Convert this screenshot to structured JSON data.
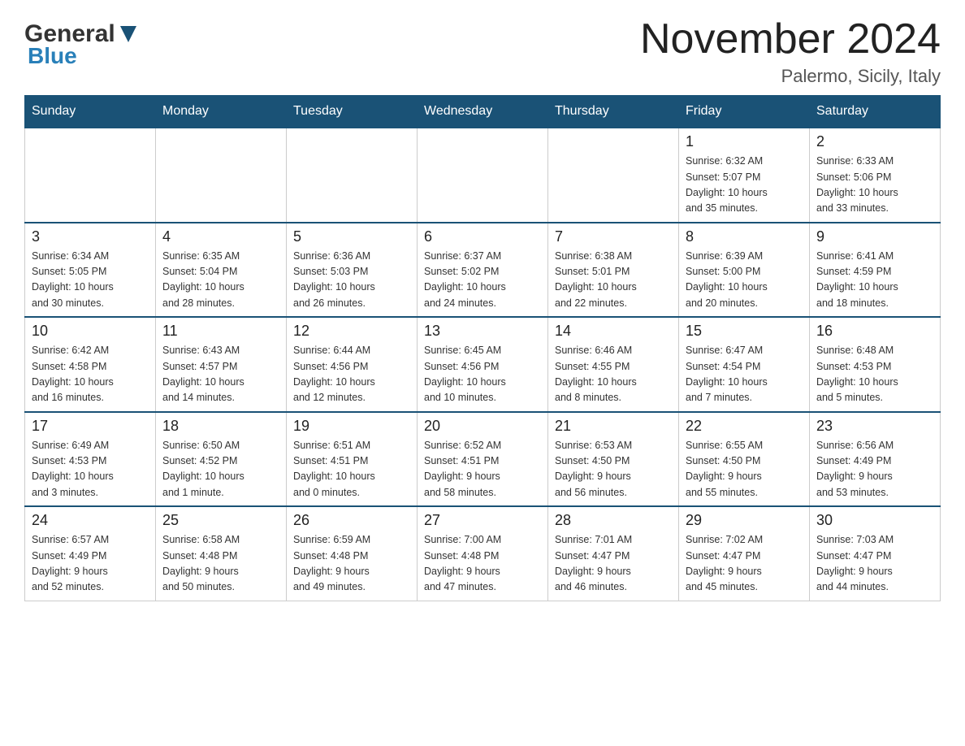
{
  "header": {
    "title": "November 2024",
    "location": "Palermo, Sicily, Italy",
    "logo_general": "General",
    "logo_blue": "Blue"
  },
  "days_of_week": [
    "Sunday",
    "Monday",
    "Tuesday",
    "Wednesday",
    "Thursday",
    "Friday",
    "Saturday"
  ],
  "weeks": [
    {
      "days": [
        {
          "number": "",
          "info": ""
        },
        {
          "number": "",
          "info": ""
        },
        {
          "number": "",
          "info": ""
        },
        {
          "number": "",
          "info": ""
        },
        {
          "number": "",
          "info": ""
        },
        {
          "number": "1",
          "info": "Sunrise: 6:32 AM\nSunset: 5:07 PM\nDaylight: 10 hours\nand 35 minutes."
        },
        {
          "number": "2",
          "info": "Sunrise: 6:33 AM\nSunset: 5:06 PM\nDaylight: 10 hours\nand 33 minutes."
        }
      ]
    },
    {
      "days": [
        {
          "number": "3",
          "info": "Sunrise: 6:34 AM\nSunset: 5:05 PM\nDaylight: 10 hours\nand 30 minutes."
        },
        {
          "number": "4",
          "info": "Sunrise: 6:35 AM\nSunset: 5:04 PM\nDaylight: 10 hours\nand 28 minutes."
        },
        {
          "number": "5",
          "info": "Sunrise: 6:36 AM\nSunset: 5:03 PM\nDaylight: 10 hours\nand 26 minutes."
        },
        {
          "number": "6",
          "info": "Sunrise: 6:37 AM\nSunset: 5:02 PM\nDaylight: 10 hours\nand 24 minutes."
        },
        {
          "number": "7",
          "info": "Sunrise: 6:38 AM\nSunset: 5:01 PM\nDaylight: 10 hours\nand 22 minutes."
        },
        {
          "number": "8",
          "info": "Sunrise: 6:39 AM\nSunset: 5:00 PM\nDaylight: 10 hours\nand 20 minutes."
        },
        {
          "number": "9",
          "info": "Sunrise: 6:41 AM\nSunset: 4:59 PM\nDaylight: 10 hours\nand 18 minutes."
        }
      ]
    },
    {
      "days": [
        {
          "number": "10",
          "info": "Sunrise: 6:42 AM\nSunset: 4:58 PM\nDaylight: 10 hours\nand 16 minutes."
        },
        {
          "number": "11",
          "info": "Sunrise: 6:43 AM\nSunset: 4:57 PM\nDaylight: 10 hours\nand 14 minutes."
        },
        {
          "number": "12",
          "info": "Sunrise: 6:44 AM\nSunset: 4:56 PM\nDaylight: 10 hours\nand 12 minutes."
        },
        {
          "number": "13",
          "info": "Sunrise: 6:45 AM\nSunset: 4:56 PM\nDaylight: 10 hours\nand 10 minutes."
        },
        {
          "number": "14",
          "info": "Sunrise: 6:46 AM\nSunset: 4:55 PM\nDaylight: 10 hours\nand 8 minutes."
        },
        {
          "number": "15",
          "info": "Sunrise: 6:47 AM\nSunset: 4:54 PM\nDaylight: 10 hours\nand 7 minutes."
        },
        {
          "number": "16",
          "info": "Sunrise: 6:48 AM\nSunset: 4:53 PM\nDaylight: 10 hours\nand 5 minutes."
        }
      ]
    },
    {
      "days": [
        {
          "number": "17",
          "info": "Sunrise: 6:49 AM\nSunset: 4:53 PM\nDaylight: 10 hours\nand 3 minutes."
        },
        {
          "number": "18",
          "info": "Sunrise: 6:50 AM\nSunset: 4:52 PM\nDaylight: 10 hours\nand 1 minute."
        },
        {
          "number": "19",
          "info": "Sunrise: 6:51 AM\nSunset: 4:51 PM\nDaylight: 10 hours\nand 0 minutes."
        },
        {
          "number": "20",
          "info": "Sunrise: 6:52 AM\nSunset: 4:51 PM\nDaylight: 9 hours\nand 58 minutes."
        },
        {
          "number": "21",
          "info": "Sunrise: 6:53 AM\nSunset: 4:50 PM\nDaylight: 9 hours\nand 56 minutes."
        },
        {
          "number": "22",
          "info": "Sunrise: 6:55 AM\nSunset: 4:50 PM\nDaylight: 9 hours\nand 55 minutes."
        },
        {
          "number": "23",
          "info": "Sunrise: 6:56 AM\nSunset: 4:49 PM\nDaylight: 9 hours\nand 53 minutes."
        }
      ]
    },
    {
      "days": [
        {
          "number": "24",
          "info": "Sunrise: 6:57 AM\nSunset: 4:49 PM\nDaylight: 9 hours\nand 52 minutes."
        },
        {
          "number": "25",
          "info": "Sunrise: 6:58 AM\nSunset: 4:48 PM\nDaylight: 9 hours\nand 50 minutes."
        },
        {
          "number": "26",
          "info": "Sunrise: 6:59 AM\nSunset: 4:48 PM\nDaylight: 9 hours\nand 49 minutes."
        },
        {
          "number": "27",
          "info": "Sunrise: 7:00 AM\nSunset: 4:48 PM\nDaylight: 9 hours\nand 47 minutes."
        },
        {
          "number": "28",
          "info": "Sunrise: 7:01 AM\nSunset: 4:47 PM\nDaylight: 9 hours\nand 46 minutes."
        },
        {
          "number": "29",
          "info": "Sunrise: 7:02 AM\nSunset: 4:47 PM\nDaylight: 9 hours\nand 45 minutes."
        },
        {
          "number": "30",
          "info": "Sunrise: 7:03 AM\nSunset: 4:47 PM\nDaylight: 9 hours\nand 44 minutes."
        }
      ]
    }
  ]
}
